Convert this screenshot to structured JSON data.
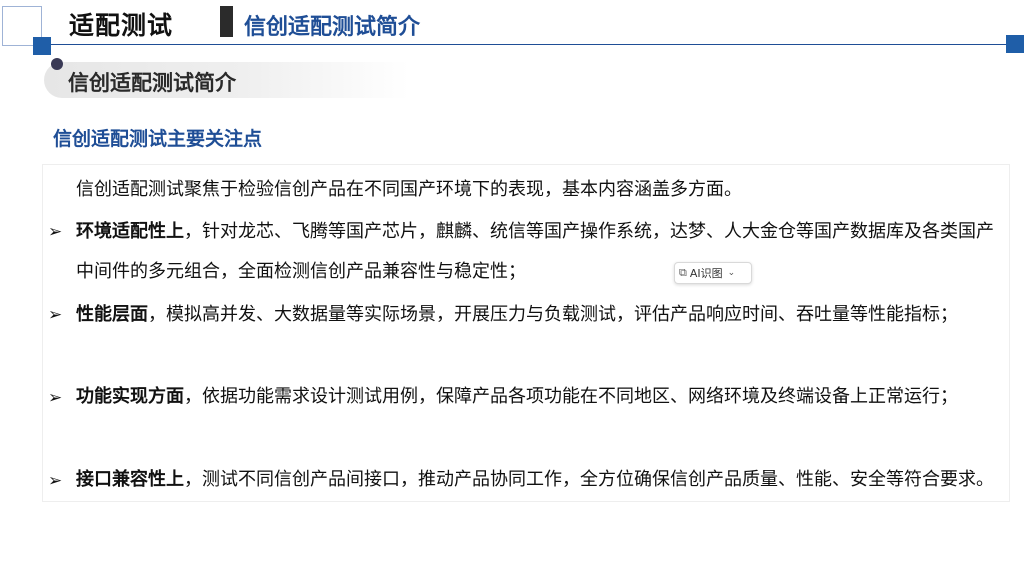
{
  "header": {
    "title": "适配测试",
    "subtitle": "信创适配测试简介"
  },
  "section": {
    "label": "信创适配测试简介"
  },
  "content": {
    "heading": "信创适配测试主要关注点",
    "intro": "信创适配测试聚焦于检验信创产品在不同国产环境下的表现，基本内容涵盖多方面。",
    "bullets": [
      {
        "title": "环境适配性上",
        "text": "，针对龙芯、飞腾等国产芯片，麒麟、统信等国产操作系统，达梦、人大金仓等国产数据库及各类国产中间件的多元组合，全面检测信创产品兼容性与稳定性；"
      },
      {
        "title": "性能层面",
        "text": "，模拟高并发、大数据量等实际场景，开展压力与负载测试，评估产品响应时间、吞吐量等性能指标；"
      },
      {
        "title": "功能实现方面",
        "text": "，依据功能需求设计测试用例，保障产品各项功能在不同地区、网络环境及终端设备上正常运行；"
      },
      {
        "title": "接口兼容性上",
        "text": "，测试不同信创产品间接口，推动产品协同工作，全方位确保信创产品质量、性能、安全等符合要求。"
      }
    ]
  },
  "ai_badge": {
    "label": "AI识图",
    "icon": "ai-scan-icon"
  },
  "colors": {
    "accent": "#1f4e96",
    "square": "#1f5ea8"
  }
}
